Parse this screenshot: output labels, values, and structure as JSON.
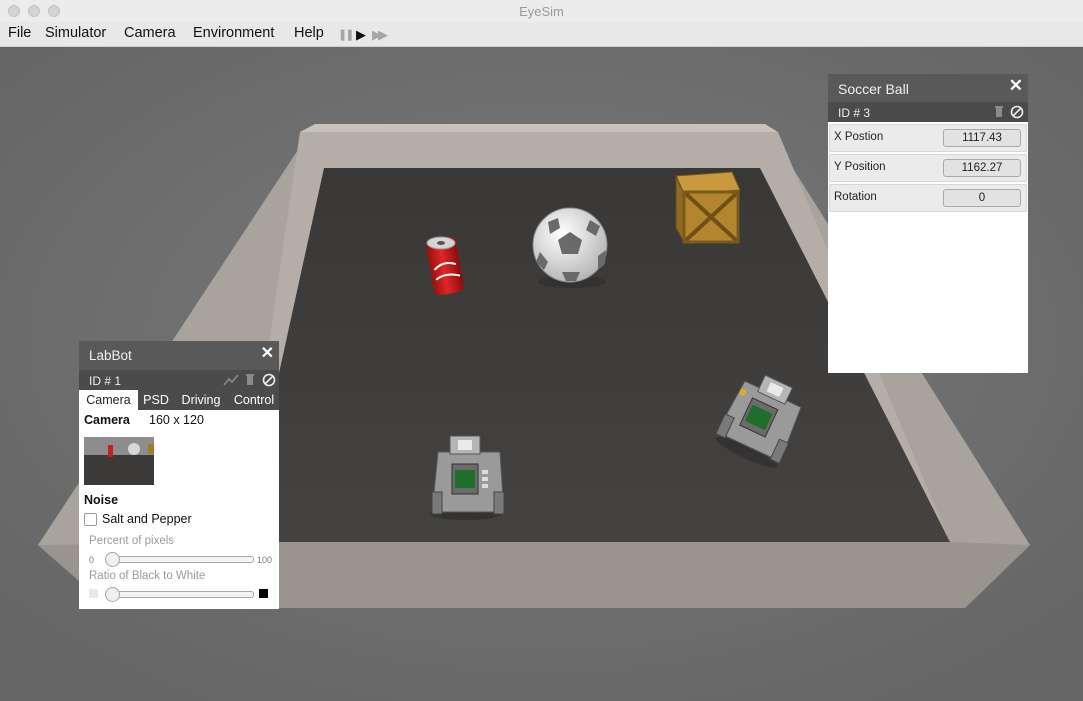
{
  "window": {
    "title": "EyeSim"
  },
  "menu": {
    "file": "File",
    "simulator": "Simulator",
    "camera": "Camera",
    "environment": "Environment",
    "help": "Help"
  },
  "playback": {
    "pause": "❚❚",
    "play": "▶",
    "fast_forward": "▶▶"
  },
  "soccer_panel": {
    "title": "Soccer Ball",
    "id_label": "ID # 3",
    "fields": [
      {
        "label": "X Postion",
        "value": "1117.43"
      },
      {
        "label": "Y Position",
        "value": "1162.27"
      },
      {
        "label": "Rotation",
        "value": "0"
      }
    ]
  },
  "labbot_panel": {
    "title": "LabBot",
    "id_label": "ID # 1",
    "tabs": [
      "Camera",
      "PSD",
      "Driving",
      "Control"
    ],
    "active_tab": "Camera",
    "camera_label": "Camera",
    "camera_resolution": "160 x 120",
    "noise_label": "Noise",
    "salt_pepper_label": "Salt and Pepper",
    "salt_pepper_checked": false,
    "percent_label": "Percent of pixels",
    "percent_min": "0",
    "percent_max": "100",
    "percent_value": 0,
    "ratio_label": "Ratio of Black to White",
    "ratio_value": 0
  },
  "colors": {
    "panel_header": "#595959",
    "id_bar": "#4b4b4b",
    "arena_floor": "#3f3d3b",
    "arena_wall": "#bdb6b0",
    "background": "#6b6b6b"
  }
}
